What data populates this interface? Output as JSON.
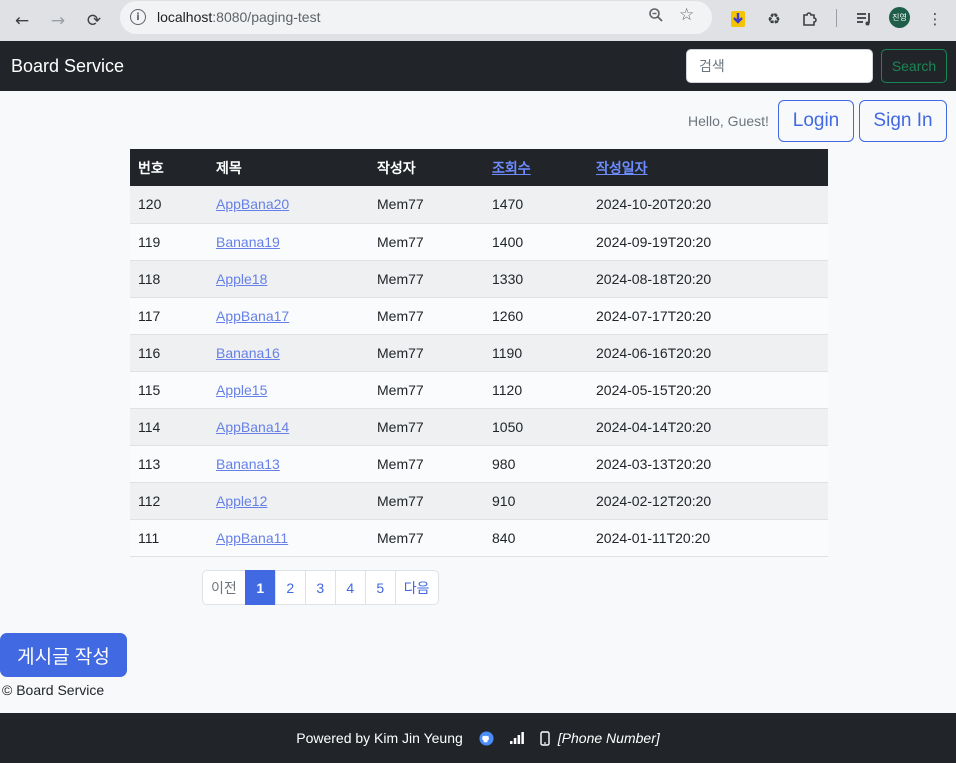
{
  "browser": {
    "url_host": "localhost",
    "url_path": ":8080/paging-test",
    "avatar_text": "진영"
  },
  "navbar": {
    "brand": "Board Service",
    "search_placeholder": "검색",
    "search_button": "Search"
  },
  "auth": {
    "greeting": "Hello, Guest!",
    "login": "Login",
    "sign_in": "Sign In"
  },
  "table": {
    "headers": {
      "no": "번호",
      "title": "제목",
      "author": "작성자",
      "views": "조회수",
      "date": "작성일자"
    },
    "rows": [
      {
        "no": "120",
        "title": "AppBana20",
        "author": "Mem77",
        "views": "1470",
        "date": "2024-10-20T20:20"
      },
      {
        "no": "119",
        "title": "Banana19",
        "author": "Mem77",
        "views": "1400",
        "date": "2024-09-19T20:20"
      },
      {
        "no": "118",
        "title": "Apple18",
        "author": "Mem77",
        "views": "1330",
        "date": "2024-08-18T20:20"
      },
      {
        "no": "117",
        "title": "AppBana17",
        "author": "Mem77",
        "views": "1260",
        "date": "2024-07-17T20:20"
      },
      {
        "no": "116",
        "title": "Banana16",
        "author": "Mem77",
        "views": "1190",
        "date": "2024-06-16T20:20"
      },
      {
        "no": "115",
        "title": "Apple15",
        "author": "Mem77",
        "views": "1120",
        "date": "2024-05-15T20:20"
      },
      {
        "no": "114",
        "title": "AppBana14",
        "author": "Mem77",
        "views": "1050",
        "date": "2024-04-14T20:20"
      },
      {
        "no": "113",
        "title": "Banana13",
        "author": "Mem77",
        "views": "980",
        "date": "2024-03-13T20:20"
      },
      {
        "no": "112",
        "title": "Apple12",
        "author": "Mem77",
        "views": "910",
        "date": "2024-02-12T20:20"
      },
      {
        "no": "111",
        "title": "AppBana11",
        "author": "Mem77",
        "views": "840",
        "date": "2024-01-11T20:20"
      }
    ]
  },
  "pagination": {
    "prev": "이전",
    "pages": [
      "1",
      "2",
      "3",
      "4",
      "5"
    ],
    "active": "1",
    "next": "다음"
  },
  "write_button": "게시글 작성",
  "copyright": "© Board Service",
  "footer": {
    "powered": "Powered by Kim Jin Yeung",
    "phone": "[Phone Number]"
  },
  "colors": {
    "accent": "#4169e1",
    "dark": "#212529",
    "success": "#198754"
  }
}
